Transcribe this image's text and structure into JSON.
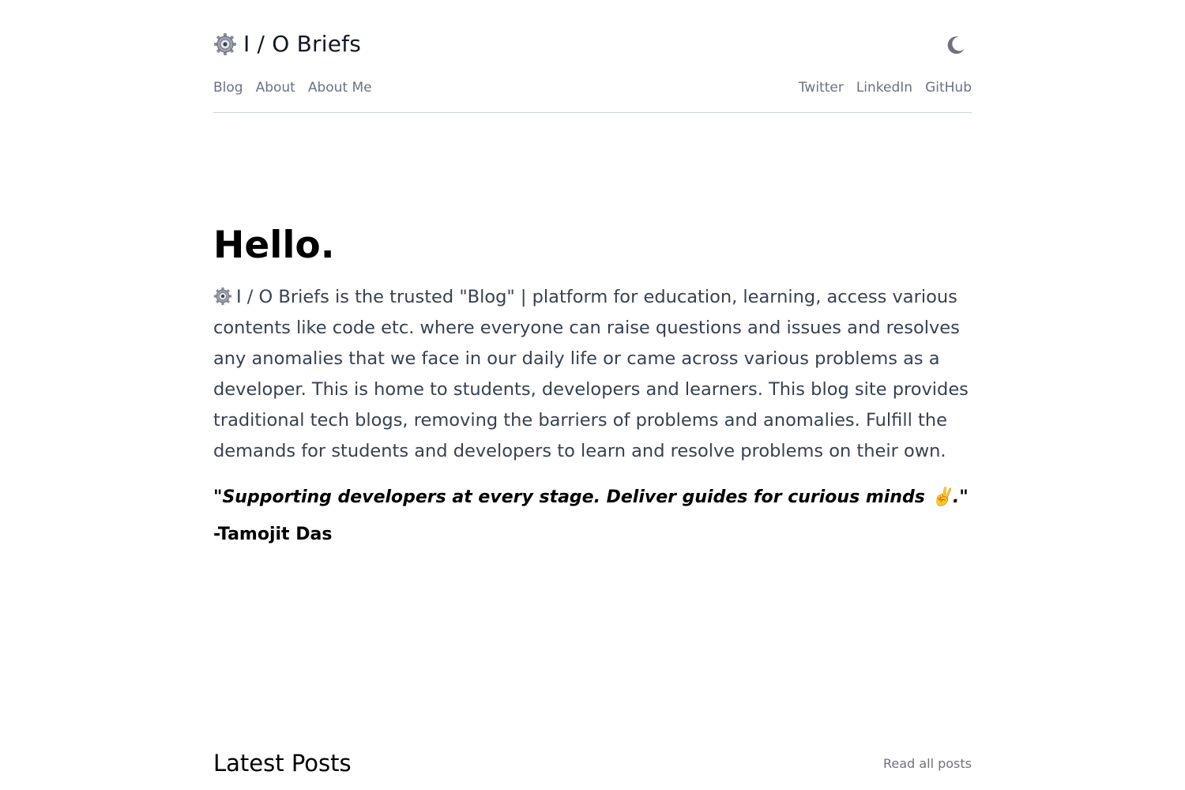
{
  "header": {
    "site_title": "I / O Briefs",
    "logo_icon": "gear-icon",
    "theme_toggle_icon": "moon-icon"
  },
  "nav": {
    "left": [
      {
        "label": "Blog"
      },
      {
        "label": "About"
      },
      {
        "label": "About Me"
      }
    ],
    "right": [
      {
        "label": "Twitter"
      },
      {
        "label": "LinkedIn"
      },
      {
        "label": "GitHub"
      }
    ]
  },
  "hero": {
    "title": "Hello.",
    "intro": "I / O Briefs is the trusted \"Blog\" | platform for education, learning, access various contents like code etc. where everyone can raise questions and issues and resolves any anomalies that we face in our daily life or came across various problems as a developer. This is home to students, developers and learners. This blog site provides traditional tech blogs, removing the barriers of problems and anomalies. Fulfill the demands for students and developers to learn and resolve problems on their own.",
    "quote": "\"Supporting developers at every stage. Deliver guides for curious minds ✌️.\"",
    "author": "-Tamojit Das"
  },
  "latest": {
    "title": "Latest Posts",
    "read_all_label": "Read all posts"
  },
  "colors": {
    "nav_text": "#6b7280",
    "body_text": "#374151",
    "divider": "#cbd5e1",
    "moon": "#6b7280"
  }
}
